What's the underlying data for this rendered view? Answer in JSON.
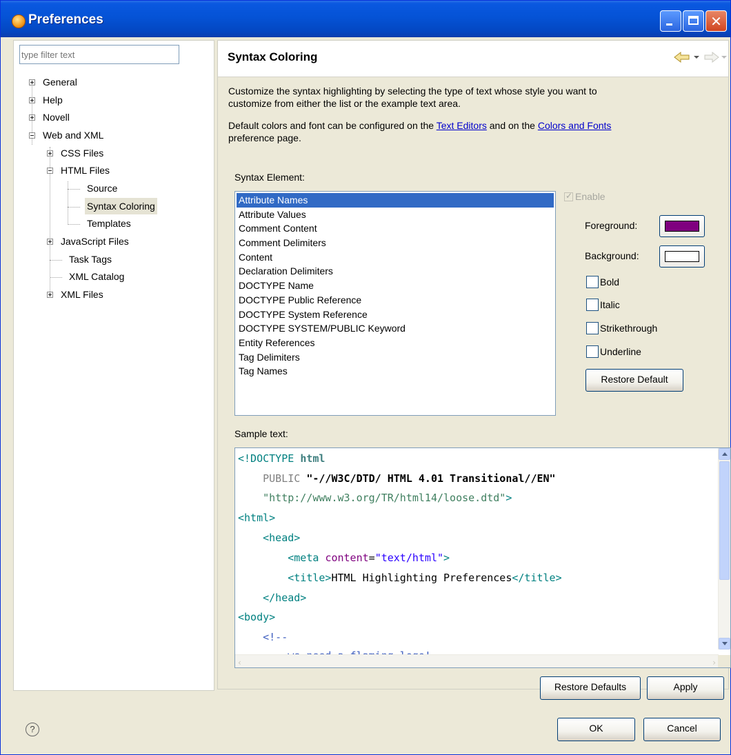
{
  "window": {
    "title": "Preferences"
  },
  "filter": {
    "placeholder": "type filter text"
  },
  "tree": {
    "general": "General",
    "help": "Help",
    "novell": "Novell",
    "web_xml": "Web and XML",
    "css_files": "CSS Files",
    "html_files": "HTML Files",
    "source": "Source",
    "syntax_coloring": "Syntax Coloring",
    "templates": "Templates",
    "javascript_files": "JavaScript Files",
    "task_tags": "Task Tags",
    "xml_catalog": "XML Catalog",
    "xml_files": "XML Files",
    "selected": "Syntax Coloring"
  },
  "page": {
    "title": "Syntax Coloring",
    "desc1_line1": "Customize the syntax highlighting by selecting the type of text whose style you want to",
    "desc1_line2": "customize from either the list or the example text area.",
    "desc2_pre": "Default colors and font can be configured on the ",
    "desc2_link1": "Text Editors",
    "desc2_mid": " and on the ",
    "desc2_link2": "Colors and Fonts",
    "desc2_line2": "preference page.",
    "syntax_element_label": "Syntax Element:",
    "sample_text_label": "Sample text:"
  },
  "syntax_elements": {
    "items": [
      "Attribute Names",
      "Attribute Values",
      "Comment Content",
      "Comment Delimiters",
      "Content",
      "Declaration Delimiters",
      "DOCTYPE Name",
      "DOCTYPE Public Reference",
      "DOCTYPE System Reference",
      "DOCTYPE SYSTEM/PUBLIC Keyword",
      "Entity References",
      "Tag Delimiters",
      "Tag Names"
    ],
    "selected": "Attribute Names"
  },
  "style": {
    "enable_label": "Enable",
    "enable_checked": true,
    "enable_disabled": true,
    "foreground_label": "Foreground:",
    "foreground_color": "#7f007f",
    "background_label": "Background:",
    "background_color": "#ffffff",
    "bold_label": "Bold",
    "italic_label": "Italic",
    "strikethrough_label": "Strikethrough",
    "underline_label": "Underline",
    "restore_default_label": "Restore Default"
  },
  "sample": {
    "l1_delim": "<!DOCTYPE",
    "l1_name": "html",
    "l2_keyword": "PUBLIC",
    "l2_ref": "\"-//W3C/DTD/ HTML 4.01 Transitional//EN\"",
    "l3_ref": "\"http://www.w3.org/TR/html14/loose.dtd\"",
    "l3_delim": ">",
    "l4": "<html>",
    "l5": "<head>",
    "l6_open": "<meta",
    "l6_attr": "content",
    "l6_eq": "=",
    "l6_val": "\"text/html\"",
    "l6_close": ">",
    "l7_open": "<title>",
    "l7_text": "HTML Highlighting Preferences",
    "l7_close": "</title>",
    "l8": "</head>",
    "l9": "<body>",
    "l10": "<!--",
    "l11": "we need a flaming logo!"
  },
  "buttons": {
    "restore_defaults": "Restore Defaults",
    "apply": "Apply",
    "ok": "OK",
    "cancel": "Cancel"
  },
  "icons": {
    "app": "eclipse-icon",
    "help": "help-icon",
    "help_glyph": "?",
    "back": "back-arrow-icon",
    "forward": "forward-arrow-icon"
  }
}
